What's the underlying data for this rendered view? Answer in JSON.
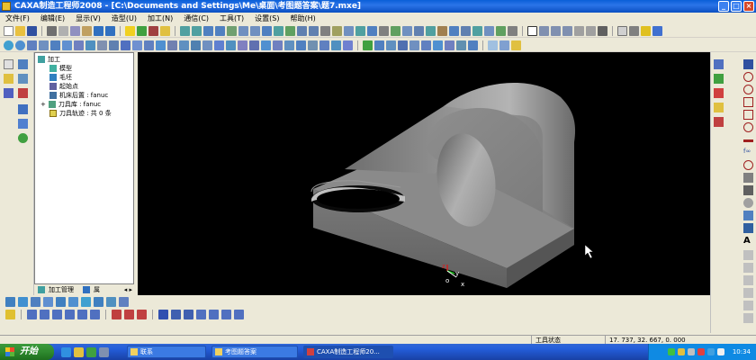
{
  "window": {
    "title": "CAXA制造工程师2008 - [C:\\Documents and Settings\\Me\\桌面\\考图题答案\\题7.mxe]",
    "buttons": [
      "_",
      "□",
      "×"
    ]
  },
  "menu": [
    "文件(F)",
    "编辑(E)",
    "显示(V)",
    "造型(U)",
    "加工(N)",
    "通信(C)",
    "工具(T)",
    "设置(S)",
    "帮助(H)"
  ],
  "tree": {
    "root": "加工",
    "items": [
      {
        "label": "模型",
        "icon": "model-icon"
      },
      {
        "label": "毛坯",
        "icon": "blank-icon"
      },
      {
        "label": "起始点",
        "icon": "start-point-icon"
      },
      {
        "label": "机床后置 : fanuc",
        "icon": "machine-icon"
      },
      {
        "label": "刀具库 : fanuc",
        "icon": "tool-library-icon"
      },
      {
        "label": "刀具轨迹 : 共 0 条",
        "icon": "toolpath-icon"
      }
    ],
    "tabs": [
      "加工管理",
      "属"
    ]
  },
  "viewport": {
    "axis_labels": [
      "z",
      "y",
      "x",
      "o"
    ]
  },
  "status": {
    "state": "工具状态",
    "coords": "17. 737, 32. 667, 0. 000"
  },
  "taskbar": {
    "start": "开始",
    "tasks": [
      "联系",
      "考图题答案",
      "CAXA制造工程师20..."
    ],
    "clock": "10:34"
  },
  "colors": {
    "title_bar": "#0a5fd8",
    "viewport_bg": "#000000",
    "model_gray": "#8c8c8c",
    "start_green": "#2f8a2f"
  }
}
